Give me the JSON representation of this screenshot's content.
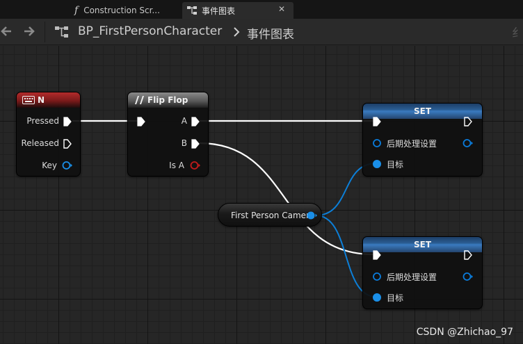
{
  "tabs": [
    {
      "label": "Construction Scr...",
      "active": false
    },
    {
      "label": "事件图表",
      "active": true
    }
  ],
  "breadcrumb": {
    "blueprint": "BP_FirstPersonCharacter",
    "graph": "事件图表"
  },
  "nodes": {
    "key_event": {
      "title": "N",
      "pins": {
        "pressed": "Pressed",
        "released": "Released",
        "key": "Key"
      }
    },
    "flip_flop": {
      "title": "Flip Flop",
      "pins": {
        "a": "A",
        "b": "B",
        "is_a": "Is A"
      }
    },
    "set_1": {
      "title": "SET",
      "pins": {
        "post_process": "后期处理设置",
        "target": "目标"
      }
    },
    "set_2": {
      "title": "SET",
      "pins": {
        "post_process": "后期处理设置",
        "target": "目标"
      }
    },
    "camera_var": {
      "label": "First Person Camera"
    }
  },
  "colors": {
    "exec_pin": "#ffffff",
    "struct_pin": "#0a7cdc",
    "object_pin": "#1a8fe8",
    "bool_pin": "#c21b1b",
    "event_header": "#9a2222",
    "set_header": "#3a7bc0"
  },
  "watermark": "CSDN @Zhichao_97"
}
